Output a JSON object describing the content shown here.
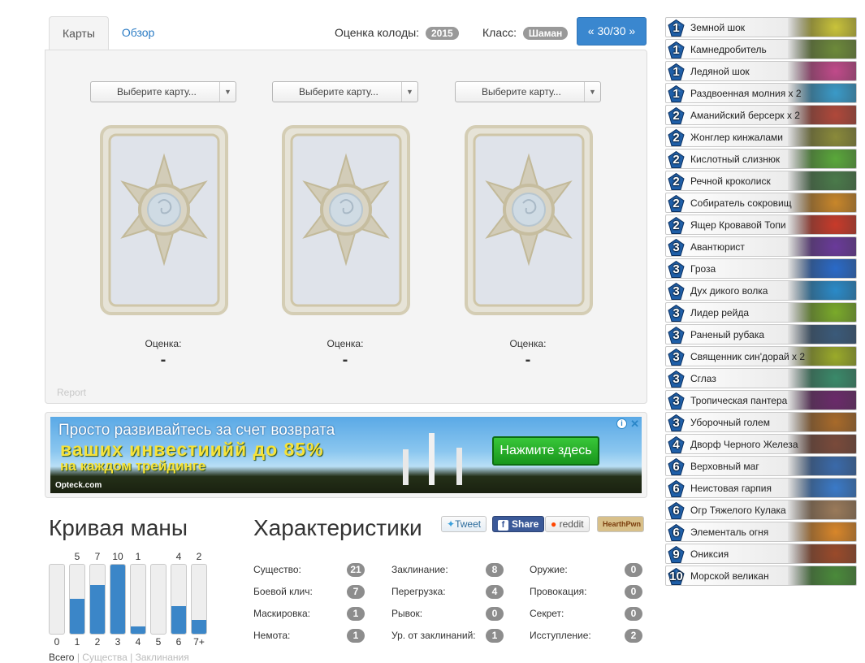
{
  "tabs": [
    {
      "label": "Карты",
      "active": true
    },
    {
      "label": "Обзор",
      "active": false
    }
  ],
  "header": {
    "rating_label": "Оценка колоды:",
    "rating_value": "2015",
    "class_label": "Класс:",
    "class_value": "Шаман",
    "progress_button": "« 30/30 »"
  },
  "slots": [
    {
      "placeholder": "Выберите карту...",
      "score_label": "Оценка:",
      "score_value": "-"
    },
    {
      "placeholder": "Выберите карту...",
      "score_label": "Оценка:",
      "score_value": "-"
    },
    {
      "placeholder": "Выберите карту...",
      "score_label": "Оценка:",
      "score_value": "-"
    }
  ],
  "report_label": "Report",
  "ad": {
    "line1": "Просто развивайтесь за счет возврата",
    "line2": "ваших инвестиийй до 85%",
    "line3": "на каждом трейдинге",
    "cta": "Нажмите здесь",
    "brand": "Opteck.com",
    "info_icon": "i",
    "close_icon": "✕"
  },
  "mana_curve": {
    "title": "Кривая маны",
    "bars": [
      {
        "label": "0",
        "count": "",
        "value": 0
      },
      {
        "label": "1",
        "count": "5",
        "value": 5
      },
      {
        "label": "2",
        "count": "7",
        "value": 7
      },
      {
        "label": "3",
        "count": "10",
        "value": 10
      },
      {
        "label": "4",
        "count": "1",
        "value": 1
      },
      {
        "label": "5",
        "count": "",
        "value": 0
      },
      {
        "label": "6",
        "count": "4",
        "value": 4
      },
      {
        "label": "7+",
        "count": "2",
        "value": 2
      }
    ],
    "max": 10,
    "filters": {
      "all": "Всего",
      "sep": "|",
      "creatures": "Существа",
      "spells": "Заклинания"
    }
  },
  "stats": {
    "title": "Характеристики",
    "share": {
      "twitter": "Tweet",
      "facebook": "Share",
      "reddit": "reddit",
      "hearthpwn": "HearthPwn"
    },
    "items": [
      {
        "label": "Существо:",
        "value": "21"
      },
      {
        "label": "Заклинание:",
        "value": "8"
      },
      {
        "label": "Оружие:",
        "value": "0"
      },
      {
        "label": "Боевой клич:",
        "value": "7"
      },
      {
        "label": "Перегрузка:",
        "value": "4"
      },
      {
        "label": "Провокация:",
        "value": "0"
      },
      {
        "label": "Маскировка:",
        "value": "1"
      },
      {
        "label": "Рывок:",
        "value": "0"
      },
      {
        "label": "Секрет:",
        "value": "0"
      },
      {
        "label": "Немота:",
        "value": "1"
      },
      {
        "label": "Ур. от заклинаний:",
        "value": "1"
      },
      {
        "label": "Исступление:",
        "value": "2"
      }
    ]
  },
  "deck": [
    {
      "cost": "1",
      "name": "Земной шок",
      "art": "#c9c33a"
    },
    {
      "cost": "1",
      "name": "Камнедробитель",
      "art": "#6d8a3a"
    },
    {
      "cost": "1",
      "name": "Ледяной шок",
      "art": "#c04a8a"
    },
    {
      "cost": "1",
      "name": "Раздвоенная молния х 2",
      "art": "#3a9ac8"
    },
    {
      "cost": "2",
      "name": "Аманийский берсерк х 2",
      "art": "#b0483a"
    },
    {
      "cost": "2",
      "name": "Жонглер кинжалами",
      "art": "#8a8a3a"
    },
    {
      "cost": "2",
      "name": "Кислотный слизнюк",
      "art": "#5aa83a"
    },
    {
      "cost": "2",
      "name": "Речной кроколиск",
      "art": "#4a7a4a"
    },
    {
      "cost": "2",
      "name": "Собиратель сокровищ",
      "art": "#c8862a"
    },
    {
      "cost": "2",
      "name": "Ящер Кровавой Топи",
      "art": "#c83a2a"
    },
    {
      "cost": "3",
      "name": "Авантюрист",
      "art": "#6a3a9a"
    },
    {
      "cost": "3",
      "name": "Гроза",
      "art": "#2a6ac8"
    },
    {
      "cost": "3",
      "name": "Дух дикого волка",
      "art": "#2a8ac8"
    },
    {
      "cost": "3",
      "name": "Лидер рейда",
      "art": "#7aaa2a"
    },
    {
      "cost": "3",
      "name": "Раненый рубака",
      "art": "#3a5a7a"
    },
    {
      "cost": "3",
      "name": "Священник син'дорай х 2",
      "art": "#9aaa2a"
    },
    {
      "cost": "3",
      "name": "Сглаз",
      "art": "#3a8a6a"
    },
    {
      "cost": "3",
      "name": "Тропическая пантера",
      "art": "#6a2a6a"
    },
    {
      "cost": "3",
      "name": "Уборочный голем",
      "art": "#a86a2a"
    },
    {
      "cost": "4",
      "name": "Дворф Черного Железа",
      "art": "#7a4a3a"
    },
    {
      "cost": "6",
      "name": "Верховный маг",
      "art": "#3a6aaa"
    },
    {
      "cost": "6",
      "name": "Неистовая гарпия",
      "art": "#3a7ac8"
    },
    {
      "cost": "6",
      "name": "Огр Тяжелого Кулака",
      "art": "#9a7a5a"
    },
    {
      "cost": "6",
      "name": "Элементаль огня",
      "art": "#d8862a"
    },
    {
      "cost": "9",
      "name": "Ониксия",
      "art": "#9a4a2a"
    },
    {
      "cost": "10",
      "name": "Морской великан",
      "art": "#4a8a3a"
    }
  ]
}
